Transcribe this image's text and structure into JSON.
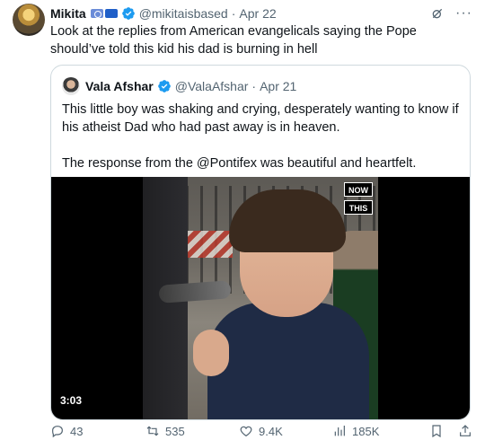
{
  "tweet": {
    "author_name": "Mikita",
    "author_handle": "@mikitaisbased",
    "date": "Apr 22",
    "text": "Look at the replies from American evangelicals saying the Pope should’ve told this kid his dad is burning in hell",
    "icons": {
      "grok": "grok-icon",
      "more": "more-icon"
    }
  },
  "quote": {
    "author_name": "Vala Afshar",
    "author_handle": "@ValaAfshar",
    "date": "Apr 21",
    "paragraph1": "This little boy was shaking and crying, desperately wanting to know if his atheist Dad who had past away is in heaven.",
    "paragraph2": "The response from the @Pontifex was beautiful and heartfelt.",
    "video": {
      "logo_top": "NOW",
      "logo_bottom": "THIS",
      "duration": "3:03"
    }
  },
  "actions": {
    "replies": "43",
    "retweets": "535",
    "likes": "9.4K",
    "views": "185K"
  },
  "colors": {
    "text": "#0f1419",
    "muted": "#536471",
    "verified": "#1d9bf0",
    "border": "#cfd9de"
  }
}
